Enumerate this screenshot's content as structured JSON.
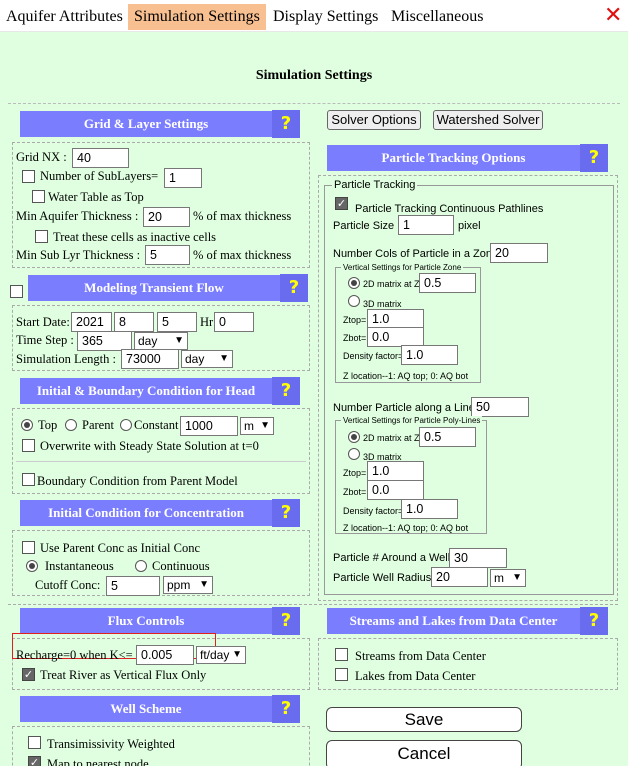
{
  "tabs": [
    "Aquifer Attributes",
    "Simulation Settings",
    "Display Settings",
    "Miscellaneous"
  ],
  "close_icon": "✕",
  "title": "Simulation Settings",
  "help": "?",
  "grid": {
    "header": "Grid & Layer Settings",
    "grid_nx_label": "Grid NX :",
    "grid_nx": "40",
    "sublayers_label": "Number of SubLayers=",
    "sublayers": "1",
    "water_table": "Water Table as Top",
    "min_thick_label": "Min Aquifer Thickness :",
    "min_thick": "20",
    "min_thick_unit": "% of max thickness",
    "inactive": "Treat these cells as inactive cells",
    "min_sub_label": "Min Sub Lyr Thickness :",
    "min_sub": "5",
    "min_sub_unit": "% of max thickness"
  },
  "transient": {
    "header": "Modeling Transient Flow",
    "start_label": "Start Date:",
    "year": "2021",
    "month": "8",
    "day": "5",
    "hr_label": "Hr",
    "hr": "0",
    "step_label": "Time Step :",
    "step": "365",
    "step_unit": "day",
    "length_label": "Simulation Length :",
    "length": "73000",
    "length_unit": "day"
  },
  "head": {
    "header": "Initial & Boundary Condition for Head",
    "top": "Top",
    "parent": "Parent",
    "constant": "Constant",
    "const_val": "1000",
    "const_unit": "m",
    "overwrite": "Overwrite with Steady State Solution at t=0",
    "boundary": "Boundary Condition from Parent Model"
  },
  "conc": {
    "header": "Initial Condition for Concentration",
    "use_parent": "Use Parent Conc as Initial Conc",
    "instant": "Instantaneous",
    "continuous": "Continuous",
    "cutoff_label": "Cutoff Conc:",
    "cutoff": "5",
    "cutoff_unit": "ppm"
  },
  "solver": {
    "solver_options": "Solver Options",
    "watershed": "Watershed Solver"
  },
  "particle": {
    "header": "Particle Tracking Options",
    "fs_label": "Particle Tracking",
    "continuous": "Particle Tracking Continuous Pathlines",
    "size_label": "Particle Size :",
    "size": "1",
    "size_unit": "pixel",
    "cols_label": "Number Cols of Particle in a Zone :",
    "cols": "20",
    "zone_fs": "Vertical Settings for Particle Zone",
    "z_2d": "2D matrix at Z=",
    "z_2d_val": "0.5",
    "z_3d": "3D matrix",
    "ztop": "Ztop=",
    "ztop_val": "1.0",
    "zbot": "Zbot=",
    "zbot_val": "0.0",
    "density": "Density factor=",
    "density_val": "1.0",
    "zloc": "Z location--1: AQ top; 0: AQ bot",
    "line_label": "Number Particle along a Line :",
    "line": "50",
    "line_fs": "Vertical Settings for Particle Poly-Lines",
    "l_2d_val": "0.5",
    "l_ztop_val": "1.0",
    "l_zbot_val": "0.0",
    "l_density_val": "1.0",
    "l_zloc": "Z location--1: AQ top; 0: AQ bot",
    "well_label": "Particle # Around a Well :",
    "well": "30",
    "radius_label": "Particle Well Radius :",
    "radius": "20",
    "radius_unit": "m"
  },
  "flux": {
    "header": "Flux Controls",
    "recharge_label": "Recharge=0 when K<=",
    "recharge": "0.005",
    "recharge_unit": "ft/day",
    "river": "Treat River as Vertical Flux Only"
  },
  "streams": {
    "header": "Streams and Lakes from Data Center",
    "streams": "Streams from Data Center",
    "lakes": "Lakes from Data Center"
  },
  "well": {
    "header": "Well Scheme",
    "trans": "Transimissivity Weighted",
    "map": "Map to nearest node"
  },
  "save": "Save",
  "cancel": "Cancel"
}
